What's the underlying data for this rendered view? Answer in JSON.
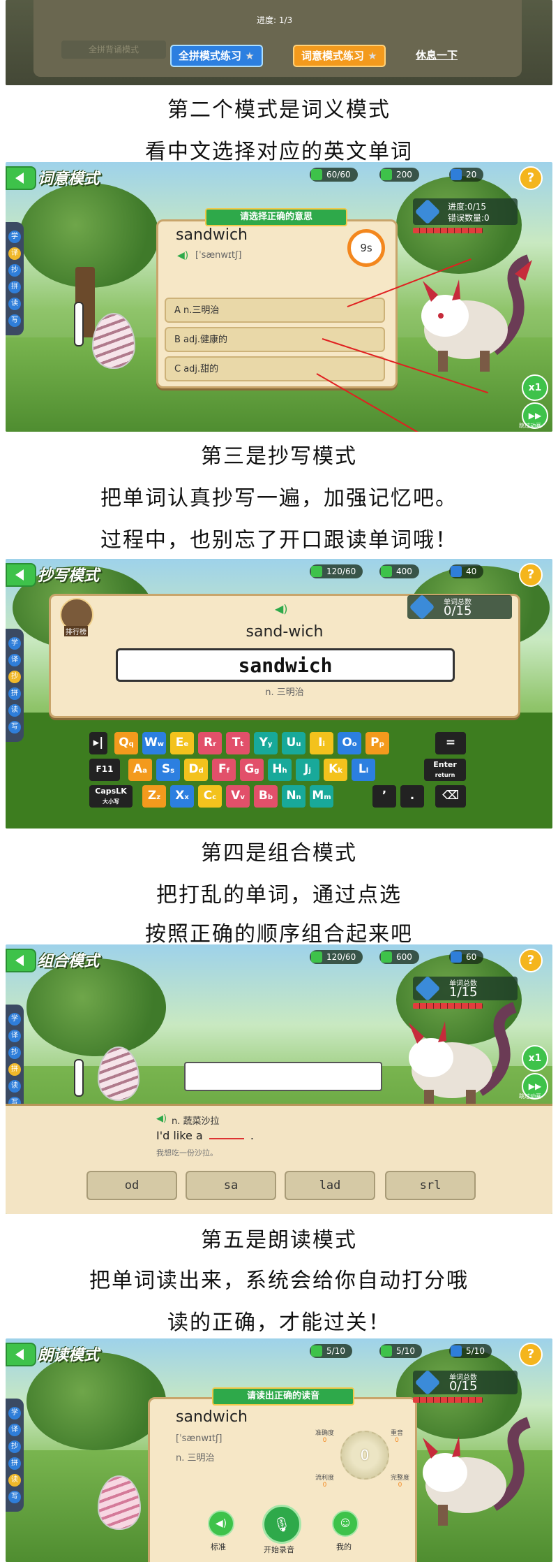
{
  "top": {
    "progress_text": "进度: 1/3",
    "faded_button": "全拼背诵模式",
    "full_spell_button": "全拼模式练习",
    "meaning_button": "词意模式练习",
    "rest_link": "休息一下"
  },
  "captions": {
    "c1": "第二个模式是词义模式",
    "c2": "看中文选择对应的英文单词",
    "c3": "第三是抄写模式",
    "c4": "把单词认真抄写一遍，加强记忆吧。",
    "c5": "过程中，也别忘了开口跟读单词哦！",
    "c6": "第四是组合模式",
    "c7": "把打乱的单词，通过点选",
    "c8": "按照正确的顺序组合起来吧",
    "c9": "第五是朗读模式",
    "c10": "把单词读出来，系统会给你自动打分哦",
    "c11": "读的正确，才能过关！"
  },
  "side_menu": [
    "学",
    "译",
    "抄",
    "拼",
    "读",
    "写"
  ],
  "meaning_mode": {
    "title": "词意模式",
    "stats": [
      "60/60",
      "200",
      "20"
    ],
    "ribbon": "请选择正确的意思",
    "word": "sandwich",
    "phonetic": "[ˈsænwɪtʃ]",
    "timer": "9s",
    "progress": "进度:0/15",
    "errors": "错误数量:0",
    "options": [
      "A  n.三明治",
      "B  adj.健康的",
      "C  adj.甜的"
    ],
    "speed": "x1",
    "skip": "跳过动画"
  },
  "copy_mode": {
    "title": "抄写模式",
    "stats": [
      "120/60",
      "400",
      "40"
    ],
    "badge": "排行榜",
    "count_label": "单词总数",
    "count": "0/15",
    "syllables": "sand-wich",
    "input_value": "sandwich",
    "meaning": "n. 三明治",
    "keys_row1": [
      [
        "Q",
        "q"
      ],
      [
        "W",
        "w"
      ],
      [
        "E",
        "e"
      ],
      [
        "R",
        "r"
      ],
      [
        "T",
        "t"
      ],
      [
        "Y",
        "y"
      ],
      [
        "U",
        "u"
      ],
      [
        "I",
        "i"
      ],
      [
        "O",
        "o"
      ],
      [
        "P",
        "p"
      ]
    ],
    "keys_row2": [
      [
        "A",
        "a"
      ],
      [
        "S",
        "s"
      ],
      [
        "D",
        "d"
      ],
      [
        "F",
        "f"
      ],
      [
        "G",
        "g"
      ],
      [
        "H",
        "h"
      ],
      [
        "J",
        "j"
      ],
      [
        "K",
        "k"
      ],
      [
        "L",
        "l"
      ]
    ],
    "keys_row3": [
      [
        "Z",
        "z"
      ],
      [
        "X",
        "x"
      ],
      [
        "C",
        "c"
      ],
      [
        "V",
        "v"
      ],
      [
        "B",
        "b"
      ],
      [
        "N",
        "n"
      ],
      [
        "M",
        "m"
      ]
    ],
    "f11": "F11",
    "enter": "Enter",
    "enter_sub": "return",
    "caps": "CapsLK",
    "caps_sub": "大小写",
    "apostrophe": "ʼ",
    "period": "."
  },
  "combo_mode": {
    "title": "组合模式",
    "stats": [
      "120/60",
      "600",
      "60"
    ],
    "count_label": "单词总数",
    "count": "1/15",
    "meaning": "n. 蔬菜沙拉",
    "sentence_prefix": "I'd like a",
    "sentence_suffix": ".",
    "translation": "我想吃一份沙拉。",
    "tiles": [
      "od",
      "sa",
      "lad",
      "srl"
    ],
    "speed": "x1",
    "skip": "跳过动画"
  },
  "read_mode": {
    "title": "朗读模式",
    "stats": [
      "5/10",
      "5/10",
      "5/10"
    ],
    "ribbon": "请读出正确的读音",
    "word": "sandwich",
    "phonetic": "[ˈsænwɪtʃ]",
    "meaning": "n. 三明治",
    "score": "0",
    "metrics": [
      {
        "label": "准确度",
        "value": "0"
      },
      {
        "label": "重音",
        "value": "0"
      },
      {
        "label": "流利度",
        "value": "0"
      },
      {
        "label": "完整度",
        "value": "0"
      }
    ],
    "count_label": "单词总数",
    "count": "0/15",
    "buttons": [
      "标准",
      "开始录音",
      "我的"
    ]
  }
}
